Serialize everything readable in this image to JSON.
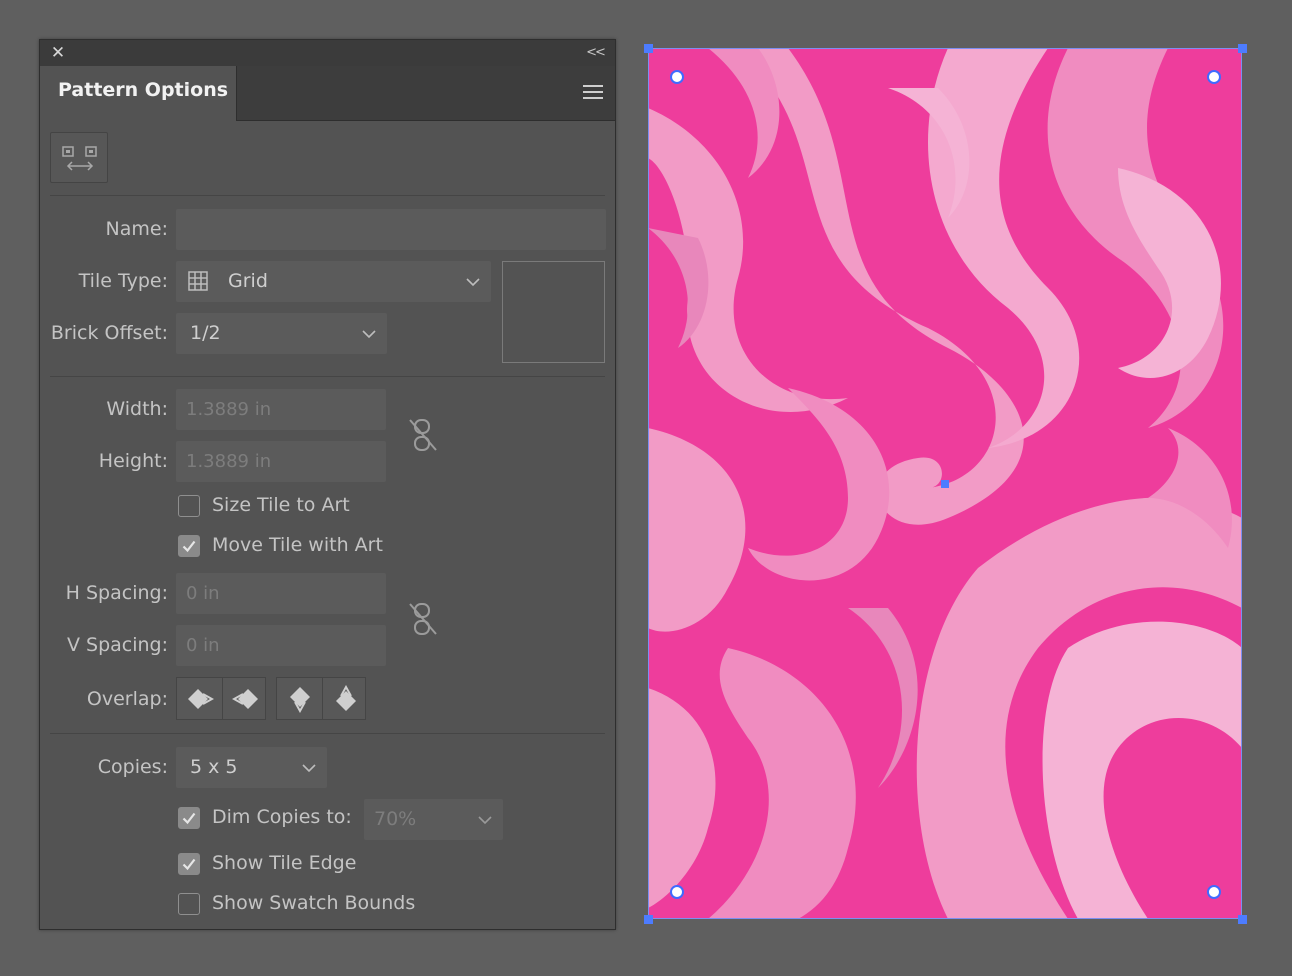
{
  "panel": {
    "title": "Pattern Options",
    "name_label": "Name:",
    "name_value": "",
    "tile_type_label": "Tile Type:",
    "tile_type_value": "Grid",
    "brick_offset_label": "Brick Offset:",
    "brick_offset_value": "1/2",
    "width_label": "Width:",
    "width_value": "1.3889 in",
    "height_label": "Height:",
    "height_value": "1.3889 in",
    "size_tile_to_art": "Size Tile to Art",
    "move_tile_with_art": "Move Tile with Art",
    "h_spacing_label": "H Spacing:",
    "h_spacing_value": "0 in",
    "v_spacing_label": "V Spacing:",
    "v_spacing_value": "0 in",
    "overlap_label": "Overlap:",
    "copies_label": "Copies:",
    "copies_value": "5 x 5",
    "dim_copies_label": "Dim Copies to:",
    "dim_copies_value": "70%",
    "show_tile_edge": "Show Tile Edge",
    "show_swatch_bounds": "Show Swatch Bounds"
  },
  "checkboxes": {
    "size_tile_to_art": false,
    "move_tile_with_art": true,
    "dim_copies": true,
    "show_tile_edge": true,
    "show_swatch_bounds": false
  },
  "icons": {
    "close": "close-icon",
    "collapse": "double-chevron-left-icon",
    "menu": "hamburger-menu-icon",
    "edit_tile": "pattern-tile-tool-icon",
    "grid": "grid-icon",
    "link": "unlinked-chain-icon"
  },
  "colors": {
    "panel_bg": "#535353",
    "selection": "#4d7cff",
    "pattern_base": "#ee3d9c",
    "pattern_light": "#f29bc6"
  }
}
